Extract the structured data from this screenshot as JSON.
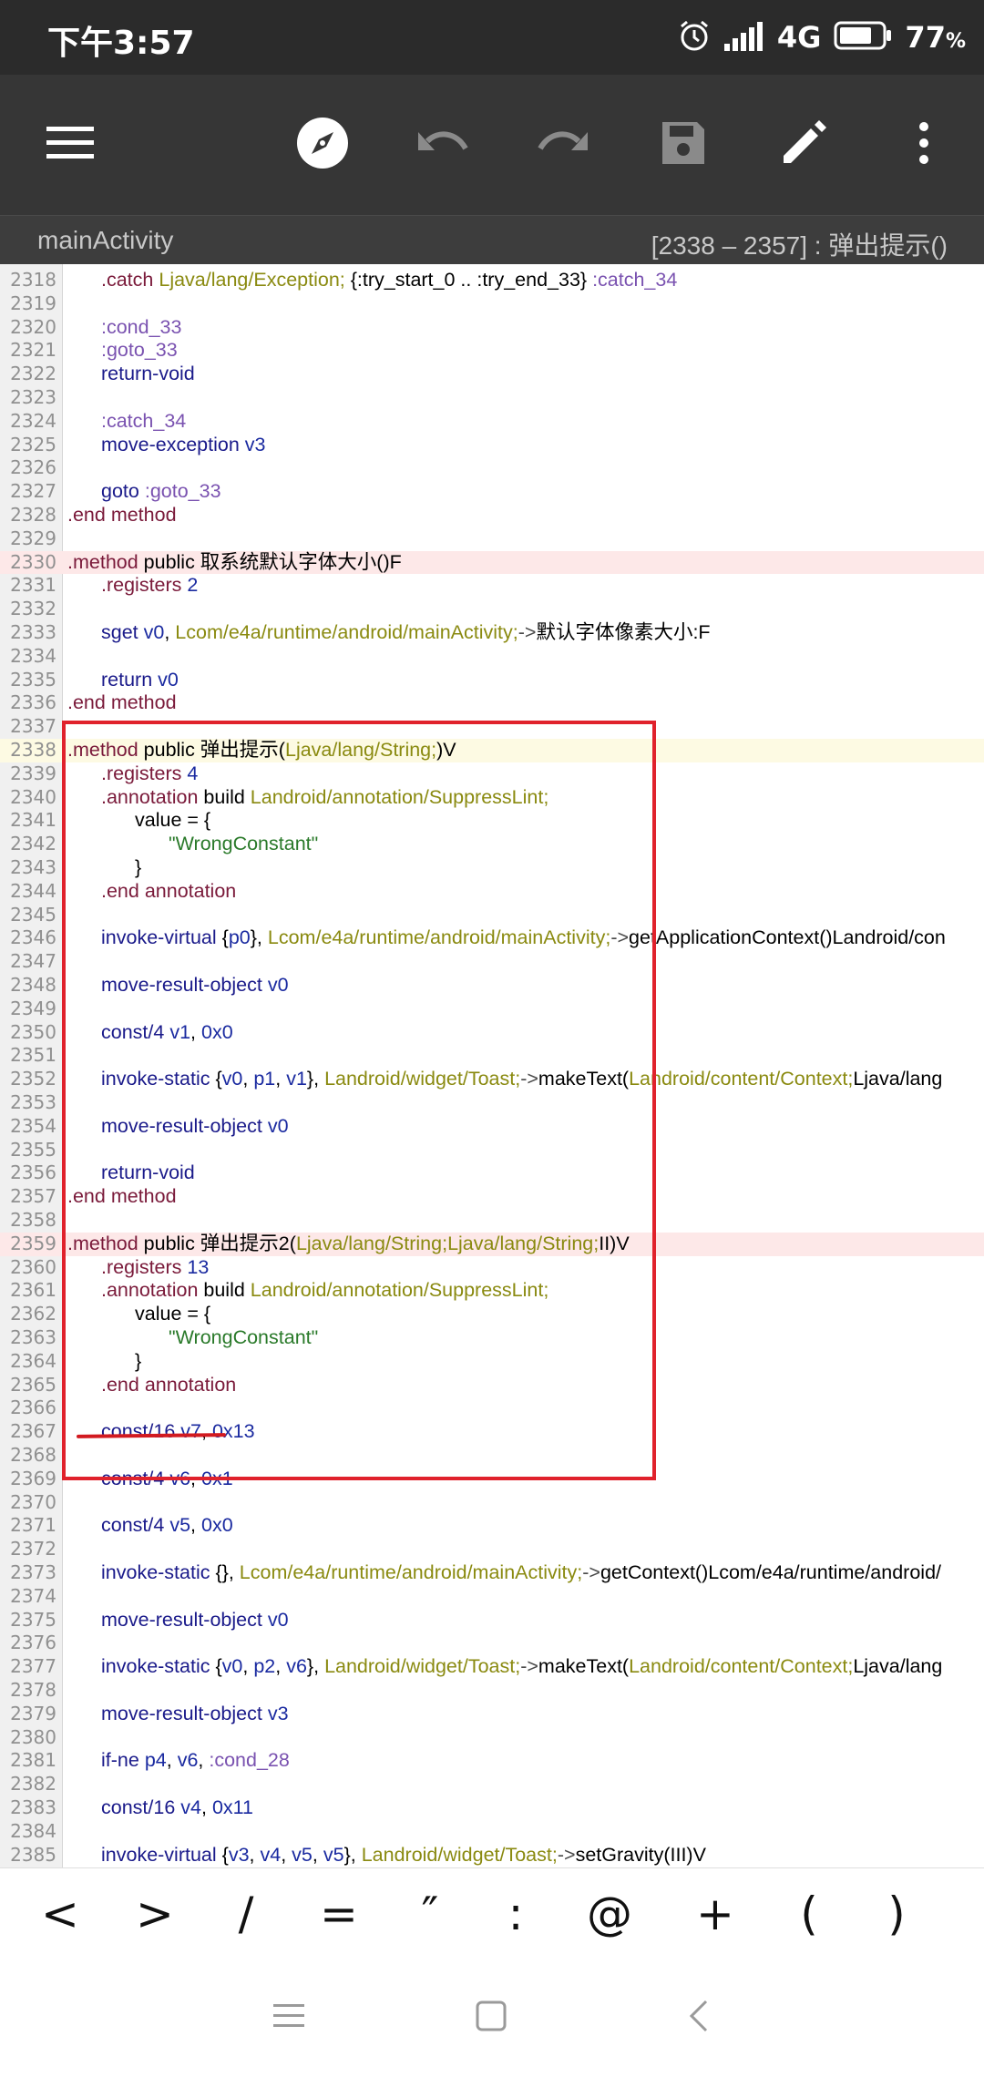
{
  "status_bar": {
    "time": "下午3:57",
    "network": "4G",
    "battery": "77",
    "battery_unit": "%",
    "icons": [
      "alarm-icon",
      "signal-icon",
      "battery-icon"
    ]
  },
  "toolbar": {
    "icons": [
      "menu-icon",
      "compass-icon",
      "undo-icon",
      "redo-icon",
      "save-icon",
      "edit-icon",
      "more-vert-icon"
    ]
  },
  "title_bar": {
    "file_name": "mainActivity",
    "range": "[2338 – 2357] : 弹出提示()"
  },
  "editor": {
    "lines": [
      {
        "n": "2318",
        "t": ".catch Ljava/lang/Exception; {:try_start_0 .. :try_end_33} :catch_34"
      },
      {
        "n": "2319",
        "t": ""
      },
      {
        "n": "2320",
        "t": ":cond_33"
      },
      {
        "n": "2321",
        "t": ":goto_33"
      },
      {
        "n": "2322",
        "t": "return-void"
      },
      {
        "n": "2323",
        "t": ""
      },
      {
        "n": "2324",
        "t": ":catch_34"
      },
      {
        "n": "2325",
        "t": "move-exception v3"
      },
      {
        "n": "2326",
        "t": ""
      },
      {
        "n": "2327",
        "t": "goto :goto_33"
      },
      {
        "n": "2328",
        "t": ".end method"
      },
      {
        "n": "2329",
        "t": ""
      },
      {
        "n": "2330",
        "t": ".method public 取系统默认字体大小()F"
      },
      {
        "n": "2331",
        "t": ".registers 2"
      },
      {
        "n": "2332",
        "t": ""
      },
      {
        "n": "2333",
        "t": "sget v0, Lcom/e4a/runtime/android/mainActivity;->默认字体像素大小:F"
      },
      {
        "n": "2334",
        "t": ""
      },
      {
        "n": "2335",
        "t": "return v0"
      },
      {
        "n": "2336",
        "t": ".end method"
      },
      {
        "n": "2337",
        "t": ""
      },
      {
        "n": "2338",
        "t": ".method public 弹出提示(Ljava/lang/String;)V"
      },
      {
        "n": "2339",
        "t": ".registers 4"
      },
      {
        "n": "2340",
        "t": ".annotation build Landroid/annotation/SuppressLint;"
      },
      {
        "n": "2341",
        "t": "value = {"
      },
      {
        "n": "2342",
        "t": "\"WrongConstant\""
      },
      {
        "n": "2343",
        "t": "}"
      },
      {
        "n": "2344",
        "t": ".end annotation"
      },
      {
        "n": "2345",
        "t": ""
      },
      {
        "n": "2346",
        "t": "invoke-virtual {p0}, Lcom/e4a/runtime/android/mainActivity;->getApplicationContext()Landroid/con"
      },
      {
        "n": "2347",
        "t": ""
      },
      {
        "n": "2348",
        "t": "move-result-object v0"
      },
      {
        "n": "2349",
        "t": ""
      },
      {
        "n": "2350",
        "t": "const/4 v1, 0x0"
      },
      {
        "n": "2351",
        "t": ""
      },
      {
        "n": "2352",
        "t": "invoke-static {v0, p1, v1}, Landroid/widget/Toast;->makeText(Landroid/content/Context;Ljava/lang"
      },
      {
        "n": "2353",
        "t": ""
      },
      {
        "n": "2354",
        "t": "move-result-object v0"
      },
      {
        "n": "2355",
        "t": ""
      },
      {
        "n": "2356",
        "t": "return-void"
      },
      {
        "n": "2357",
        "t": ".end method"
      },
      {
        "n": "2358",
        "t": ""
      },
      {
        "n": "2359",
        "t": ".method public 弹出提示2(Ljava/lang/String;Ljava/lang/String;II)V"
      },
      {
        "n": "2360",
        "t": ".registers 13"
      },
      {
        "n": "2361",
        "t": ".annotation build Landroid/annotation/SuppressLint;"
      },
      {
        "n": "2362",
        "t": "value = {"
      },
      {
        "n": "2363",
        "t": "\"WrongConstant\""
      },
      {
        "n": "2364",
        "t": "}"
      },
      {
        "n": "2365",
        "t": ".end annotation"
      },
      {
        "n": "2366",
        "t": ""
      },
      {
        "n": "2367",
        "t": "const/16 v7, 0x13"
      },
      {
        "n": "2368",
        "t": ""
      },
      {
        "n": "2369",
        "t": "const/4 v6, 0x1"
      },
      {
        "n": "2370",
        "t": ""
      },
      {
        "n": "2371",
        "t": "const/4 v5, 0x0"
      },
      {
        "n": "2372",
        "t": ""
      },
      {
        "n": "2373",
        "t": "invoke-static {}, Lcom/e4a/runtime/android/mainActivity;->getContext()Lcom/e4a/runtime/android/"
      },
      {
        "n": "2374",
        "t": ""
      },
      {
        "n": "2375",
        "t": "move-result-object v0"
      },
      {
        "n": "2376",
        "t": ""
      },
      {
        "n": "2377",
        "t": "invoke-static {v0, p2, v6}, Landroid/widget/Toast;->makeText(Landroid/content/Context;Ljava/lang"
      },
      {
        "n": "2378",
        "t": ""
      },
      {
        "n": "2379",
        "t": "move-result-object v3"
      },
      {
        "n": "2380",
        "t": ""
      },
      {
        "n": "2381",
        "t": "if-ne p4, v6, :cond_28"
      },
      {
        "n": "2382",
        "t": ""
      },
      {
        "n": "2383",
        "t": "const/16 v4, 0x11"
      },
      {
        "n": "2384",
        "t": ""
      },
      {
        "n": "2385",
        "t": "invoke-virtual {v3, v4, v5, v5}, Landroid/widget/Toast;->setGravity(III)V"
      }
    ]
  },
  "symbol_bar": {
    "keys": [
      "<",
      ">",
      "/",
      "=",
      "″",
      ":",
      "@",
      "+",
      "(",
      ")"
    ]
  },
  "nav_bar": {
    "icons": [
      "recents-icon",
      "home-icon",
      "back-icon"
    ]
  }
}
